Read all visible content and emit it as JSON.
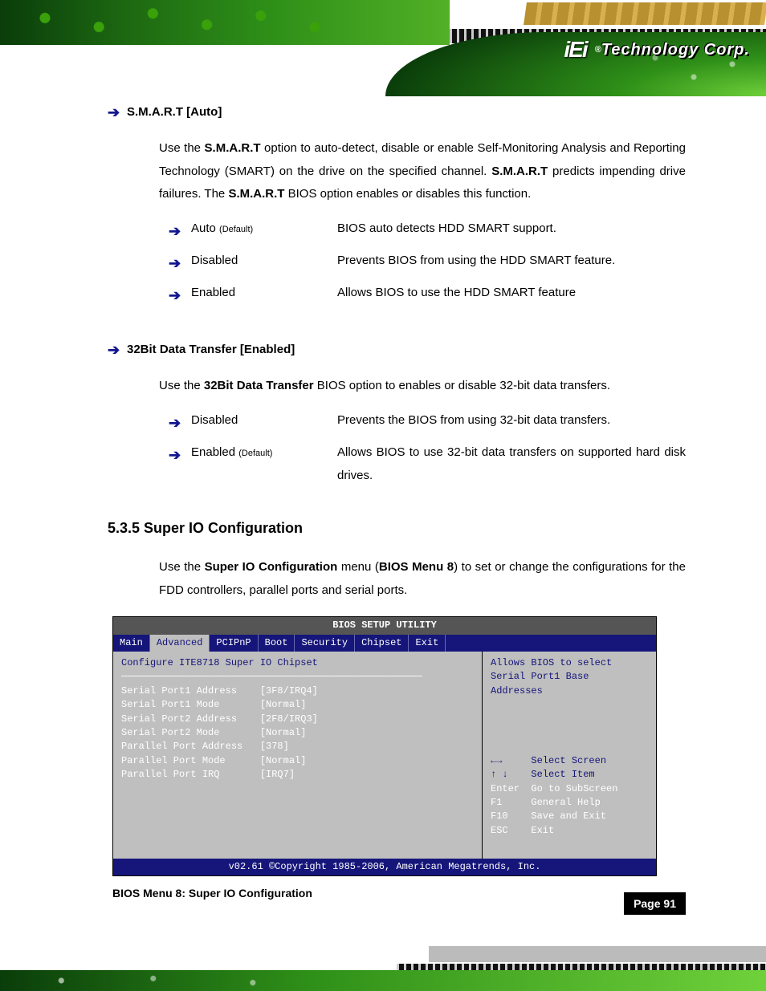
{
  "header": {
    "logo_brand": "iEi",
    "logo_text": "Technology Corp.",
    "registered": "®"
  },
  "sections": {
    "smart": {
      "title": "S.M.A.R.T [Auto]",
      "para_pre": "Use the ",
      "para_opt": "S.M.A.R.T",
      "para_mid1": " option to auto-detect, disable or enable Self-Monitoring Analysis and Reporting Technology (SMART) on the drive on the specified channel. ",
      "para_opt2": "S.M.A.R.T",
      "para_mid2": " predicts impending drive failures. The ",
      "para_opt3": "S.M.A.R.T",
      "para_end": " BIOS option enables or disables this function.",
      "options": [
        {
          "name": "Auto",
          "default": "(Default)",
          "desc": "BIOS auto detects HDD SMART support."
        },
        {
          "name": "Disabled",
          "default": "",
          "desc": "Prevents BIOS from using the HDD SMART feature."
        },
        {
          "name": "Enabled",
          "default": "",
          "desc": "Allows BIOS to use the HDD SMART feature"
        }
      ]
    },
    "bit32": {
      "title": "32Bit Data Transfer [Enabled]",
      "para_pre": "Use the ",
      "para_opt": "32Bit Data Transfer",
      "para_end": " BIOS option to enables or disable 32-bit data transfers.",
      "options": [
        {
          "name": "Disabled",
          "default": "",
          "desc": "Prevents the BIOS from using 32-bit data transfers."
        },
        {
          "name": "Enabled",
          "default": "(Default)",
          "desc": "Allows BIOS to use 32-bit data transfers on supported hard disk drives."
        }
      ]
    },
    "superio": {
      "number": "5.3.5 Super IO Configuration",
      "para_pre": "Use the ",
      "para_opt": "Super IO Configuration",
      "para_mid": " menu (",
      "para_ref": "BIOS Menu 8",
      "para_end": ") to set or change the configurations for the FDD controllers, parallel ports and serial ports."
    }
  },
  "bios": {
    "title": "BIOS SETUP UTILITY",
    "tabs": [
      "Main",
      "Advanced",
      "PCIPnP",
      "Boot",
      "Security",
      "Chipset",
      "Exit"
    ],
    "active_tab_index": 1,
    "left_heading": "Configure ITE8718 Super IO Chipset",
    "left_items": [
      "Serial Port1 Address    [3F8/IRQ4]",
      "Serial Port1 Mode       [Normal]",
      "Serial Port2 Address    [2F8/IRQ3]",
      "Serial Port2 Mode       [Normal]",
      "Parallel Port Address   [378]",
      "Parallel Port Mode      [Normal]",
      "Parallel Port IRQ       [IRQ7]"
    ],
    "right_help_top": "Allows BIOS to select\nSerial Port1 Base\nAddresses",
    "right_keys": [
      "←→     Select Screen",
      "↑ ↓    Select Item",
      "Enter  Go to SubScreen",
      "F1     General Help",
      "F10    Save and Exit",
      "ESC    Exit"
    ],
    "footer": "v02.61 ©Copyright 1985-2006, American Megatrends, Inc.",
    "caption": "BIOS Menu 8: Super IO Configuration"
  },
  "page_number": "Page 91"
}
